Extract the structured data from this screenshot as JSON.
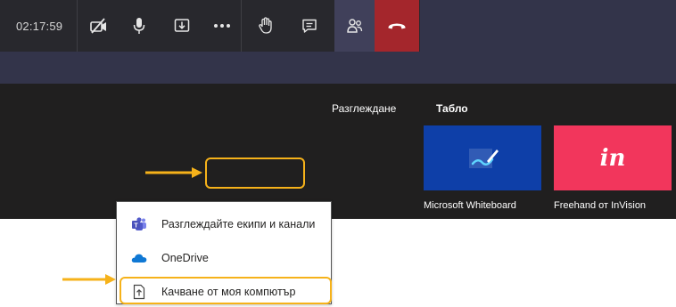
{
  "toolbar": {
    "timer": "02:17:59",
    "buttons": [
      {
        "name": "camera-off"
      },
      {
        "name": "microphone"
      },
      {
        "name": "share-tray"
      },
      {
        "name": "more"
      },
      {
        "name": "raise-hand"
      },
      {
        "name": "chat"
      },
      {
        "name": "participants"
      },
      {
        "name": "hang-up"
      }
    ],
    "colors": {
      "bar": "#28282d",
      "participants_bg": "#40405a",
      "hangup_bg": "#a4262c"
    }
  },
  "share_panel": {
    "browse_label": "Разглеждане",
    "board_label": "Табло",
    "apps": [
      {
        "caption": "Microsoft Whiteboard",
        "icon": "whiteboard-icon",
        "color": "#0e3fa8"
      },
      {
        "caption": "Freehand от InVision",
        "icon": "invision-icon",
        "logo_text": "in",
        "color": "#f2365c"
      }
    ]
  },
  "menu": {
    "items": [
      {
        "label": "Разглеждайте екипи и канали",
        "icon": "teams-icon"
      },
      {
        "label": "OneDrive",
        "icon": "onedrive-icon"
      },
      {
        "label": "Качване от моя компютър",
        "icon": "upload-file-icon"
      }
    ]
  },
  "annotation": {
    "highlight_color": "#f6b21a"
  }
}
